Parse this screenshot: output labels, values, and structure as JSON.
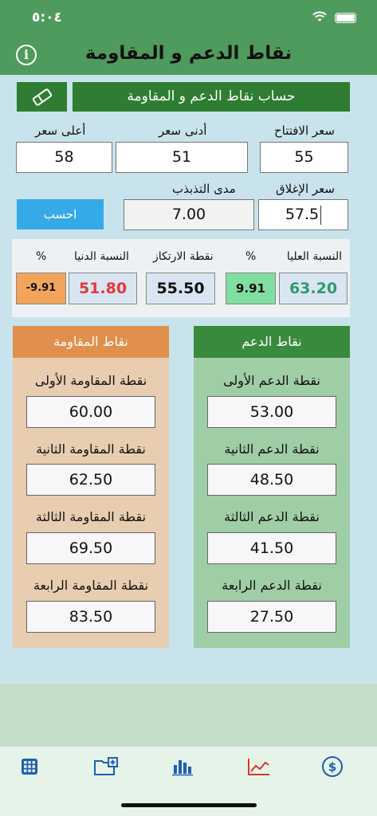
{
  "status": {
    "time": "٥:٠٤"
  },
  "app": {
    "title": "نقاط الدعم و المقاومة"
  },
  "calc": {
    "header": "حساب نقاط الدعم و المقاومة",
    "open_label": "سعر الافتتاح",
    "open_value": "55",
    "low_label": "أدنى سعر",
    "low_value": "51",
    "high_label": "أعلى سعر",
    "high_value": "58",
    "close_label": "سعر الإغلاق",
    "close_value": "57.5",
    "range_label": "مدى التذبذب",
    "range_value": "7.00",
    "calc_button": "احسب"
  },
  "ratios": {
    "upper_label": "النسبة العليا",
    "upper_value": "63.20",
    "upper_pct_label": "%",
    "upper_pct_value": "9.91",
    "pivot_label": "نقطة الارتكاز",
    "pivot_value": "55.50",
    "lower_label": "النسبة الدنيا",
    "lower_value": "51.80",
    "lower_pct_label": "%",
    "lower_pct_value": "-9.91"
  },
  "support": {
    "header": "نقاط الدعم",
    "items": [
      {
        "label": "نقطة الدعم الأولى",
        "value": "53.00"
      },
      {
        "label": "نقطة الدعم الثانية",
        "value": "48.50"
      },
      {
        "label": "نقطة الدعم الثالثة",
        "value": "41.50"
      },
      {
        "label": "نقطة الدعم الرابعة",
        "value": "27.50"
      }
    ]
  },
  "resistance": {
    "header": "نقاط المقاومة",
    "items": [
      {
        "label": "نقطة المقاومة الأولى",
        "value": "60.00"
      },
      {
        "label": "نقطة المقاومة الثانية",
        "value": "62.50"
      },
      {
        "label": "نقطة المقاومة الثالثة",
        "value": "69.50"
      },
      {
        "label": "نقطة المقاومة الرابعة",
        "value": "83.50"
      }
    ]
  },
  "tabs": [
    {
      "icon": "calculator-icon"
    },
    {
      "icon": "add-folder-icon"
    },
    {
      "icon": "bar-chart-icon"
    },
    {
      "icon": "line-chart-icon",
      "active": true
    },
    {
      "icon": "dollar-circle-icon"
    }
  ],
  "colors": {
    "header_green": "#4f9b5d",
    "dark_green": "#2e7d32",
    "calc_button_blue": "#36a9e9",
    "resistance_orange": "#e0904c",
    "positive": "#2e9a6b",
    "negative": "#e53935",
    "active_tab": "#d9362b",
    "inactive_tab": "#1e5fb0"
  }
}
